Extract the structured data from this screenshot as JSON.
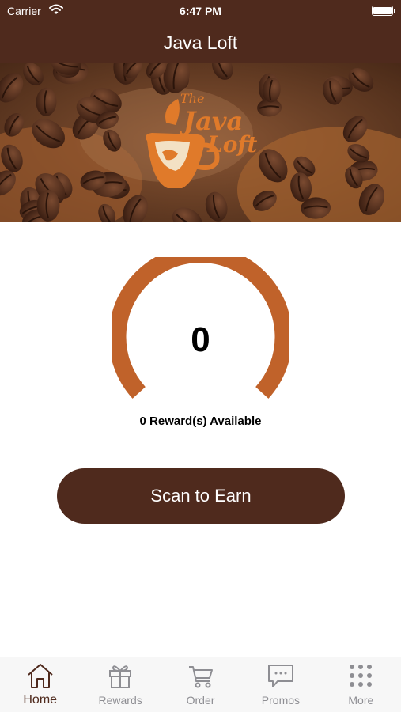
{
  "status_bar": {
    "carrier": "Carrier",
    "time": "6:47 PM"
  },
  "nav": {
    "title": "Java Loft"
  },
  "hero": {
    "logo_text": {
      "the": "The",
      "java": "Java",
      "loft": "Loft"
    }
  },
  "rewards": {
    "points": "0",
    "points_progress": 0,
    "available_text": "0 Reward(s) Available"
  },
  "scan_button": {
    "label": "Scan to Earn"
  },
  "tabs": [
    {
      "label": "Home",
      "icon": "home-icon",
      "active": true
    },
    {
      "label": "Rewards",
      "icon": "gift-icon",
      "active": false
    },
    {
      "label": "Order",
      "icon": "cart-icon",
      "active": false
    },
    {
      "label": "Promos",
      "icon": "chat-bubble-icon",
      "active": false
    },
    {
      "label": "More",
      "icon": "grid-dots-icon",
      "active": false
    }
  ],
  "colors": {
    "brand_brown": "#4f2a1d",
    "gauge_orange": "#c0622a",
    "tab_active": "#4f2a1d",
    "tab_inactive": "#8e8e93"
  }
}
